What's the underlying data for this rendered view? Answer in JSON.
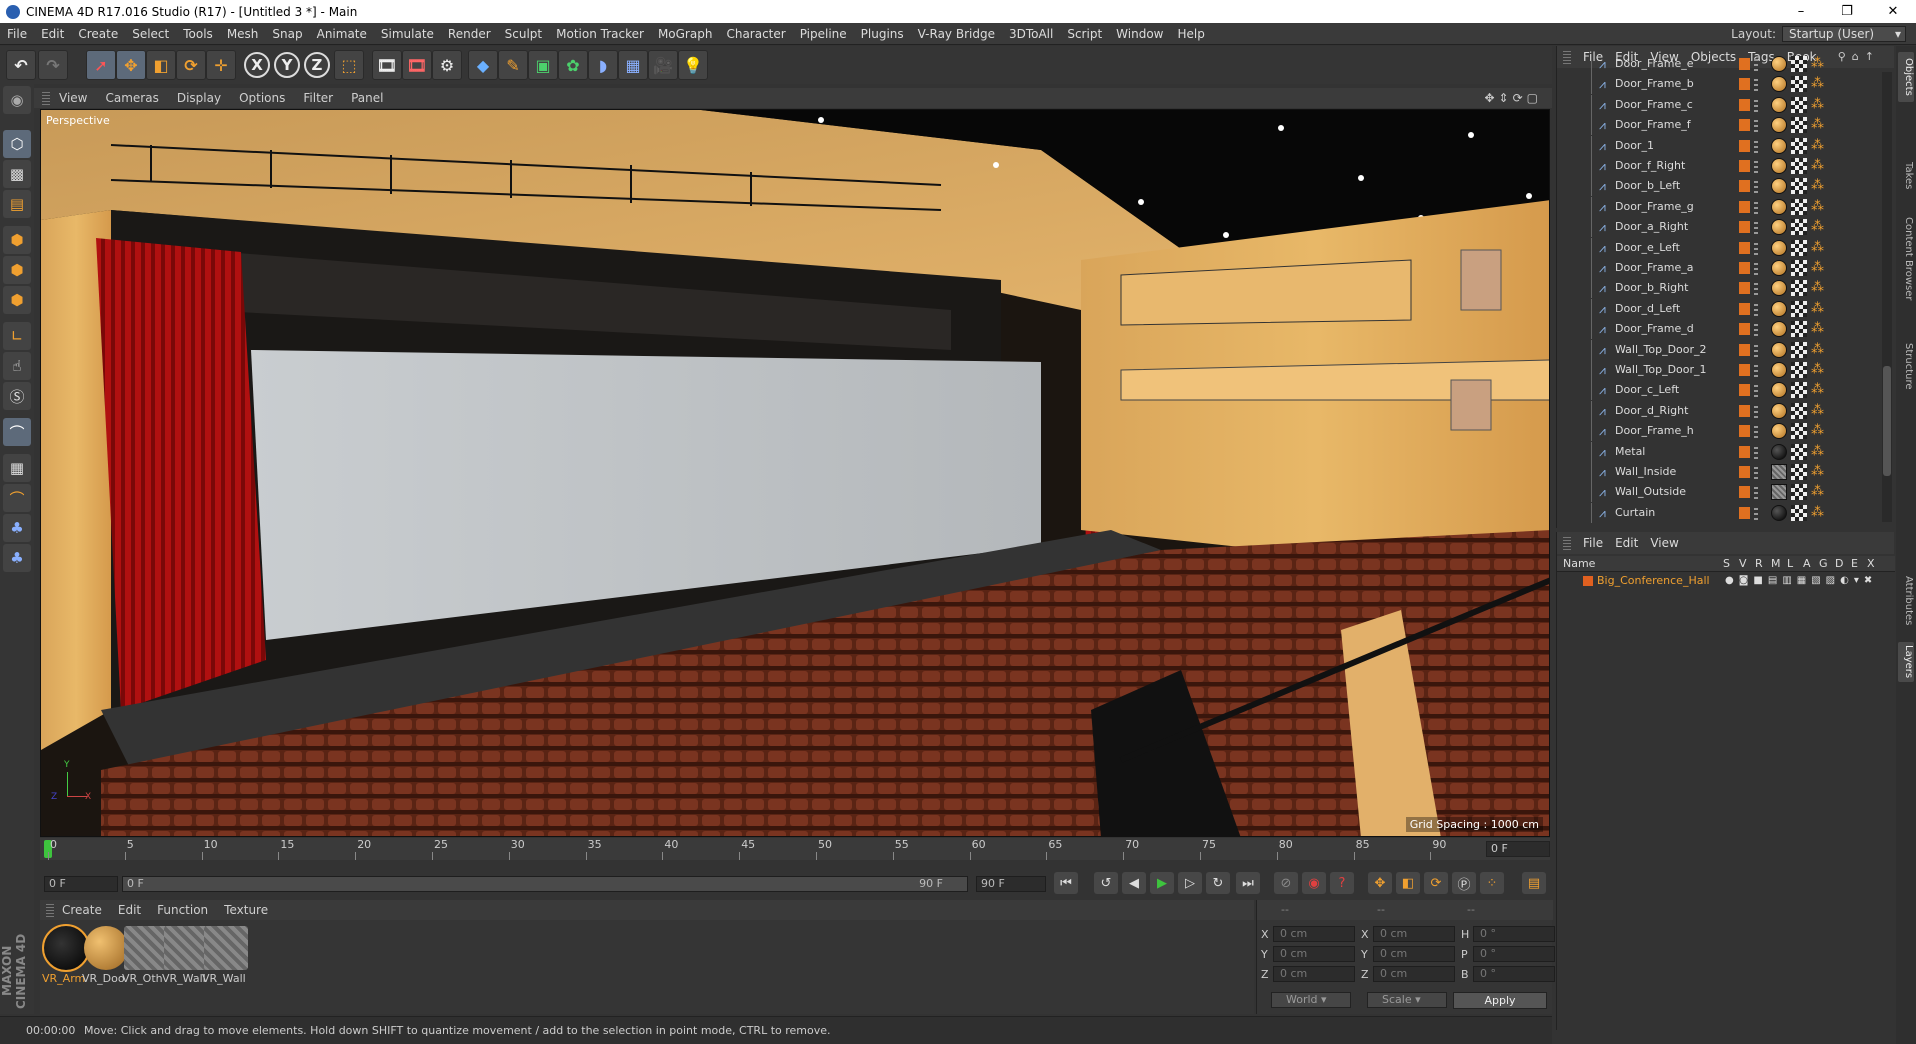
{
  "window": {
    "title": "CINEMA 4D R17.016 Studio (R17) - [Untitled 3 *] - Main"
  },
  "menubar": {
    "items": [
      "File",
      "Edit",
      "Create",
      "Select",
      "Tools",
      "Mesh",
      "Snap",
      "Animate",
      "Simulate",
      "Render",
      "Sculpt",
      "Motion Tracker",
      "MoGraph",
      "Character",
      "Pipeline",
      "Plugins",
      "V-Ray Bridge",
      "3DToAll",
      "Script",
      "Window",
      "Help"
    ]
  },
  "layout": {
    "label": "Layout:",
    "value": "Startup (User)"
  },
  "toolbar": {
    "x_label": "X",
    "y_label": "Y",
    "z_label": "Z"
  },
  "viewport": {
    "menu": [
      "View",
      "Cameras",
      "Display",
      "Options",
      "Filter",
      "Panel"
    ],
    "label": "Perspective",
    "grid_spacing": "Grid Spacing : 1000 cm",
    "axis_x": "X",
    "axis_y": "Y",
    "axis_z": "Z"
  },
  "timeline": {
    "ticks": [
      "0",
      "5",
      "10",
      "15",
      "20",
      "25",
      "30",
      "35",
      "40",
      "45",
      "50",
      "55",
      "60",
      "65",
      "70",
      "75",
      "80",
      "85",
      "90"
    ],
    "current_frame": "0 F"
  },
  "transport": {
    "start_field": "0 F",
    "range_start": "0 F",
    "range_end": "90 F",
    "end_field": "90 F"
  },
  "material_manager": {
    "menu": [
      "Create",
      "Edit",
      "Function",
      "Texture"
    ],
    "materials": [
      "VR_Arm",
      "VR_Doo",
      "VR_Oth",
      "VR_Wall",
      "VR_Wall"
    ],
    "brand_1": "MAXON",
    "brand_2": "CINEMA 4D"
  },
  "coordinates": {
    "head": [
      "--",
      "--",
      "--"
    ],
    "rows": [
      {
        "l1": "X",
        "v1": "0 cm",
        "l2": "X",
        "v2": "0 cm",
        "l3": "H",
        "v3": "0 °"
      },
      {
        "l1": "Y",
        "v1": "0 cm",
        "l2": "Y",
        "v2": "0 cm",
        "l3": "P",
        "v3": "0 °"
      },
      {
        "l1": "Z",
        "v1": "0 cm",
        "l2": "Z",
        "v2": "0 cm",
        "l3": "B",
        "v3": "0 °"
      }
    ],
    "space": "World",
    "mode": "Scale",
    "apply": "Apply"
  },
  "status": {
    "time": "00:00:00",
    "message": "Move: Click and drag to move elements. Hold down SHIFT to quantize movement / add to the selection in point mode, CTRL to remove."
  },
  "object_manager": {
    "menu": [
      "File",
      "Edit",
      "View",
      "Objects",
      "Tags",
      "Book"
    ],
    "objects": [
      {
        "name": "Door_Frame_e",
        "mat": "gold"
      },
      {
        "name": "Door_Frame_b",
        "mat": "gold"
      },
      {
        "name": "Door_Frame_c",
        "mat": "gold"
      },
      {
        "name": "Door_Frame_f",
        "mat": "gold"
      },
      {
        "name": "Door_1",
        "mat": "gold"
      },
      {
        "name": "Door_f_Right",
        "mat": "gold"
      },
      {
        "name": "Door_b_Left",
        "mat": "gold"
      },
      {
        "name": "Door_Frame_g",
        "mat": "gold"
      },
      {
        "name": "Door_a_Right",
        "mat": "gold"
      },
      {
        "name": "Door_e_Left",
        "mat": "gold"
      },
      {
        "name": "Door_Frame_a",
        "mat": "gold"
      },
      {
        "name": "Door_b_Right",
        "mat": "gold"
      },
      {
        "name": "Door_d_Left",
        "mat": "gold"
      },
      {
        "name": "Door_Frame_d",
        "mat": "gold"
      },
      {
        "name": "Wall_Top_Door_2",
        "mat": "gold"
      },
      {
        "name": "Wall_Top_Door_1",
        "mat": "gold"
      },
      {
        "name": "Door_c_Left",
        "mat": "gold"
      },
      {
        "name": "Door_d_Right",
        "mat": "gold"
      },
      {
        "name": "Door_Frame_h",
        "mat": "gold"
      },
      {
        "name": "Metal",
        "mat": "black"
      },
      {
        "name": "Wall_Inside",
        "mat": "grey"
      },
      {
        "name": "Wall_Outside",
        "mat": "grey"
      },
      {
        "name": "Curtain",
        "mat": "black"
      }
    ]
  },
  "layer_manager": {
    "menu": [
      "File",
      "Edit",
      "View"
    ],
    "columns": [
      "Name",
      "S",
      "V",
      "R",
      "M",
      "L",
      "A",
      "G",
      "D",
      "E",
      "X"
    ],
    "layer": "Big_Conference_Hall",
    "layer_color": "#e06020"
  },
  "side_tabs": [
    "Objects",
    "Takes",
    "Content Browser",
    "Structure",
    "Attributes",
    "Layers"
  ]
}
